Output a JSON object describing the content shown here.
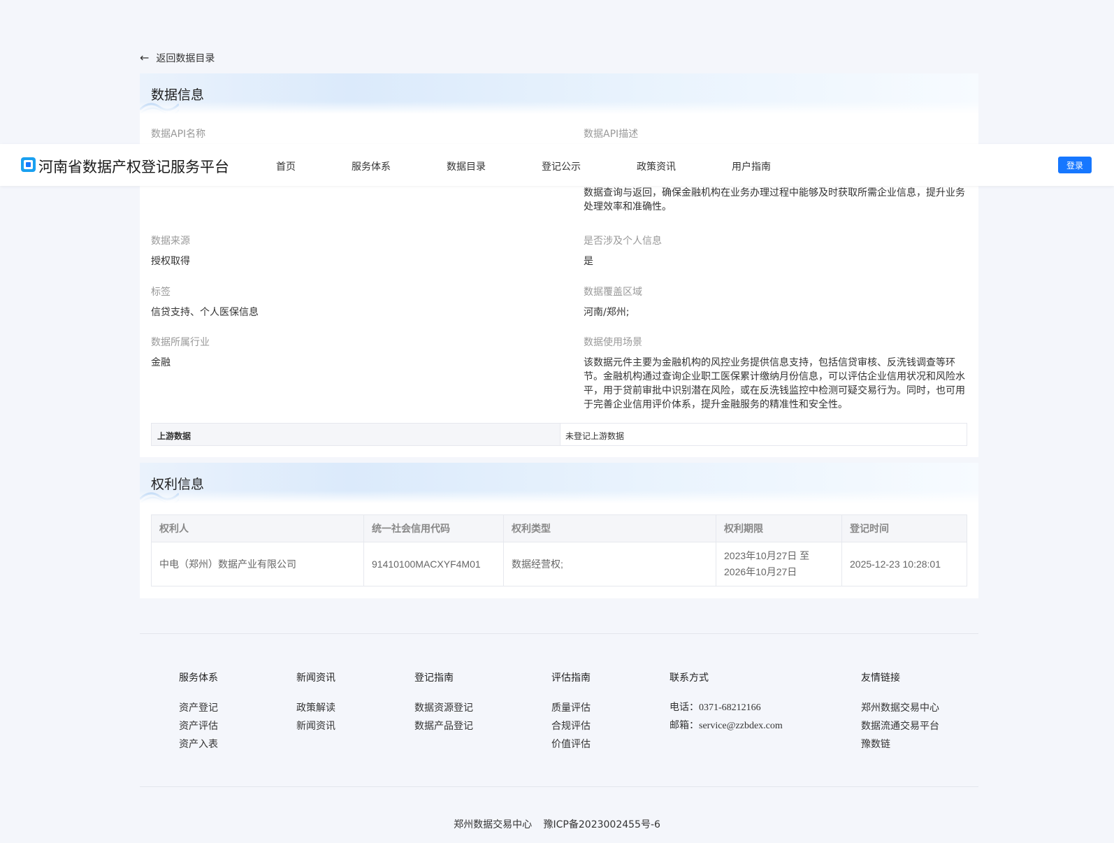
{
  "back_label": "返回数据目录",
  "data_info": {
    "title": "数据信息",
    "api_name_label": "数据API名称",
    "api_desc_label": "数据API描述",
    "api_desc_visible": "数据查询与返回，确保金融机构在业务办理过程中能够及时获取所需企业信息，提升业务处理效率和准确性。",
    "source_label": "数据来源",
    "source_value": "授权取得",
    "personal_label": "是否涉及个人信息",
    "personal_value": "是",
    "tags_label": "标签",
    "tags_value": "信贷支持、个人医保信息",
    "region_label": "数据覆盖区域",
    "region_value": "河南/郑州;",
    "industry_label": "数据所属行业",
    "industry_value": "金融",
    "scenario_label": "数据使用场景",
    "scenario_value": "该数据元件主要为金融机构的风控业务提供信息支持，包括信贷审核、反洗钱调查等环节。金融机构通过查询企业职工医保累计缴纳月份信息，可以评估企业信用状况和风险水平，用于贷前审批中识别潜在风险，或在反洗钱监控中检测可疑交易行为。同时，也可用于完善企业信用评价体系，提升金融服务的精准性和安全性。",
    "upstream_label": "上游数据",
    "upstream_value": "未登记上游数据"
  },
  "rights_info": {
    "title": "权利信息",
    "columns": [
      "权利人",
      "统一社会信用代码",
      "权利类型",
      "权利期限",
      "登记时间"
    ],
    "row": {
      "holder": "中电（郑州）数据产业有限公司",
      "credit_code": "91410100MACXYF4M01",
      "right_type": "数据经营权;",
      "term_start": "2023年10月27日 至",
      "term_end": "2026年10月27日",
      "registered": "2025-12-23 10:28:01"
    }
  },
  "navbar": {
    "brand": "河南省数据产权登记服务平台",
    "items": [
      "首页",
      "服务体系",
      "数据目录",
      "登记公示",
      "政策资讯",
      "用户指南"
    ],
    "login": "登录"
  },
  "footer": {
    "cols": [
      {
        "title": "服务体系",
        "links": [
          "资产登记",
          "资产评估",
          "资产入表"
        ]
      },
      {
        "title": "新闻资讯",
        "links": [
          "政策解读",
          "新闻资讯"
        ]
      },
      {
        "title": "登记指南",
        "links": [
          "数据资源登记",
          "数据产品登记"
        ]
      },
      {
        "title": "评估指南",
        "links": [
          "质量评估",
          "合规评估",
          "价值评估"
        ]
      },
      {
        "title": "联系方式",
        "links": [
          "电话：0371-68212166",
          "邮箱：service@zzbdex.com"
        ]
      },
      {
        "title": "友情链接",
        "links": [
          "郑州数据交易中心",
          "数据流通交易平台",
          "豫数链"
        ]
      }
    ],
    "company": "郑州数据交易中心",
    "icp": "豫ICP备2023002455号-6"
  },
  "colors": {
    "accent": "#1677ff",
    "page_bg": "#f4f6fb"
  }
}
